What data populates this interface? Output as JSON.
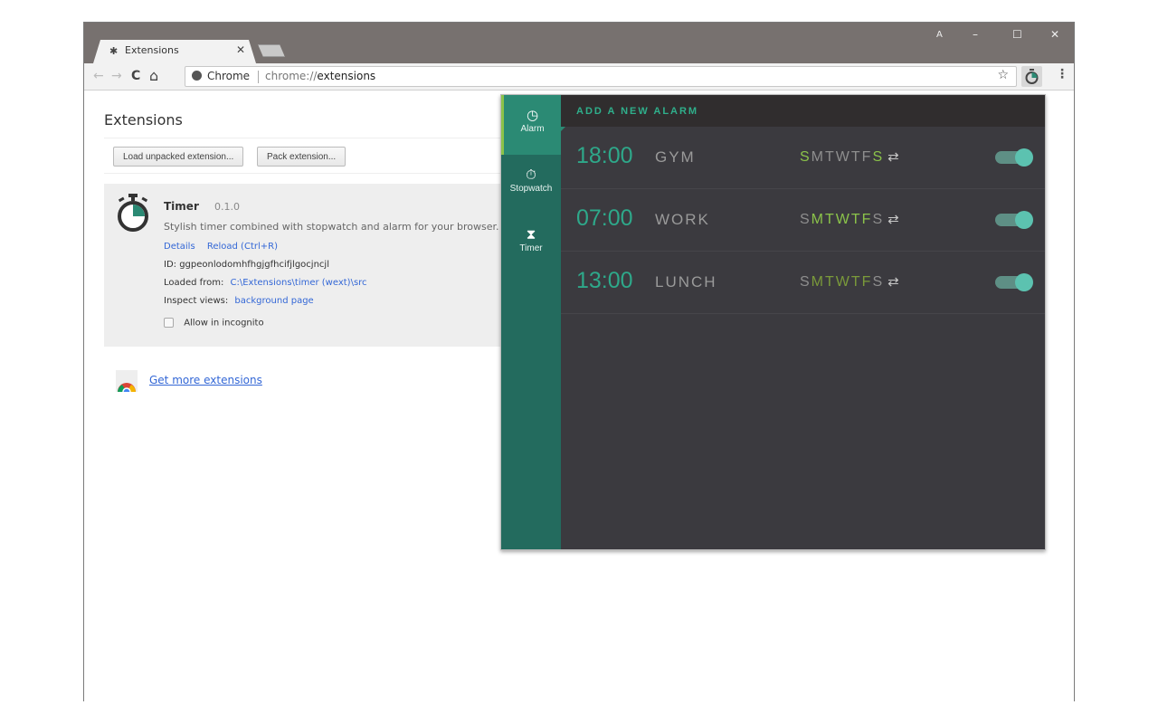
{
  "browser": {
    "tab": {
      "title": "Extensions",
      "icon": "puzzle-icon"
    },
    "window_controls": {
      "profile": "A",
      "minimize": "–",
      "maximize": "☐",
      "close": "✕"
    },
    "omnibox": {
      "scheme_label": "Chrome",
      "url_prefix": "chrome://",
      "url_main": "extensions"
    }
  },
  "page": {
    "title": "Extensions",
    "buttons": {
      "load_unpacked": "Load unpacked extension...",
      "pack": "Pack extension..."
    },
    "extension": {
      "name": "Timer",
      "version": "0.1.0",
      "description": "Stylish timer combined with stopwatch and alarm for your browser.",
      "details_link": "Details",
      "reload_link": "Reload (Ctrl+R)",
      "id_label": "ID: ggpeonlodomhfhgjgfhcifjlgocjncjl",
      "loaded_from_label": "Loaded from:",
      "loaded_from_path": "C:\\Extensions\\timer (wext)\\src",
      "inspect_label": "Inspect views:",
      "inspect_link": "background page",
      "incognito_label": "Allow in incognito",
      "incognito_checked": false
    },
    "more_extensions": "Get more extensions"
  },
  "popup": {
    "sidebar": [
      {
        "label": "Alarm",
        "icon": "clock-icon",
        "active": true
      },
      {
        "label": "Stopwatch",
        "icon": "stopwatch-icon",
        "active": false
      },
      {
        "label": "Timer",
        "icon": "hourglass-icon",
        "active": false
      }
    ],
    "add_alarm": "ADD A NEW ALARM",
    "alarms": [
      {
        "time": "18:00",
        "name": "GYM",
        "days": [
          "S",
          "M",
          "T",
          "W",
          "T",
          "F",
          "S"
        ],
        "active_days": [
          true,
          false,
          false,
          false,
          false,
          false,
          true
        ],
        "repeat": true,
        "enabled": true
      },
      {
        "time": "07:00",
        "name": "WORK",
        "days": [
          "S",
          "M",
          "T",
          "W",
          "T",
          "F",
          "S"
        ],
        "active_days": [
          false,
          true,
          true,
          true,
          true,
          true,
          false
        ],
        "repeat": true,
        "enabled": true
      },
      {
        "time": "13:00",
        "name": "LUNCH",
        "days": [
          "S",
          "M",
          "T",
          "W",
          "T",
          "F",
          "S"
        ],
        "active_days": [
          false,
          true,
          true,
          true,
          true,
          true,
          false
        ],
        "repeat": true,
        "enabled": true
      }
    ],
    "colors": {
      "accent": "#2ea88a",
      "sidebar": "#236b5e",
      "active_day": "#8bc34a",
      "background": "#3b3a3f"
    }
  }
}
